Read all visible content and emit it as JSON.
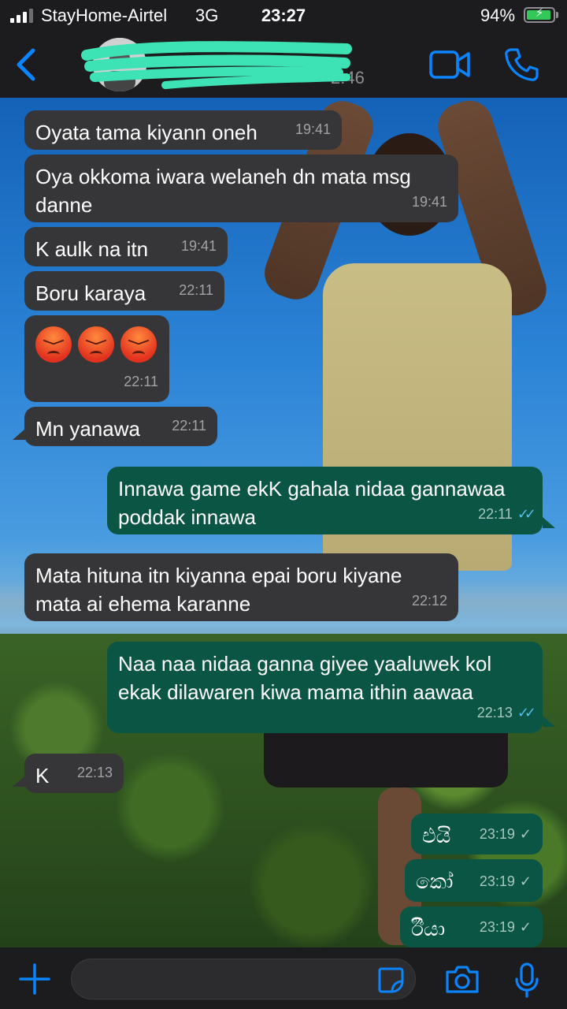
{
  "status_bar": {
    "carrier": "StayHome-Airtel",
    "network": "3G",
    "time": "23:27",
    "battery_percent": "94%",
    "battery_level": 0.94,
    "battery_icon": "charging-battery-icon"
  },
  "header": {
    "back_icon": "chevron-left-icon",
    "last_seen_visible": "2:46",
    "video_icon": "video-camera-icon",
    "call_icon": "phone-icon"
  },
  "messages": [
    {
      "dir": "in",
      "text": "Oyata tama kiyann oneh",
      "time": "19:41"
    },
    {
      "dir": "in",
      "text": "Oya okkoma iwara welaneh dn mata msg danne",
      "time": "19:41"
    },
    {
      "dir": "in",
      "text": "K aulk na itn",
      "time": "19:41"
    },
    {
      "dir": "in",
      "text": "Boru karaya",
      "time": "22:11"
    },
    {
      "dir": "in",
      "text": "",
      "emoji_count": 3,
      "emoji": "angry-face",
      "time": "22:11"
    },
    {
      "dir": "in",
      "text": "Mn yanawa",
      "time": "22:11"
    },
    {
      "dir": "out",
      "text": "Innawa game ekK gahala nidaa gannawaa poddak innawa",
      "time": "22:11",
      "status": "read"
    },
    {
      "dir": "in",
      "text": "Mata hituna itn kiyanna epai boru kiyane mata ai ehema karanne",
      "time": "22:12"
    },
    {
      "dir": "out",
      "text": "Naa naa nidaa ganna giyee yaaluwek kol ekak dilawaren kiwa mama ithin aawaa",
      "time": "22:13",
      "status": "read"
    },
    {
      "dir": "in",
      "text": "K",
      "time": "22:13"
    },
    {
      "dir": "out",
      "text": "එයි",
      "time": "23:19",
      "status": "sent"
    },
    {
      "dir": "out",
      "text": "කෝ",
      "time": "23:19",
      "status": "sent"
    },
    {
      "dir": "out",
      "text": "ඊියා",
      "time": "23:19",
      "status": "sent"
    }
  ],
  "input_bar": {
    "plus_icon": "plus-icon",
    "sticker_icon": "sticker-icon",
    "camera_icon": "camera-icon",
    "mic_icon": "microphone-icon",
    "message_value": ""
  },
  "colors": {
    "bar_background": "#1c1c1e",
    "incoming_bubble": "#363638",
    "outgoing_bubble": "#0b5545",
    "accent_blue": "#0a84ff",
    "read_tick": "#53bdeb",
    "redaction_mark": "#3ee3b5"
  }
}
